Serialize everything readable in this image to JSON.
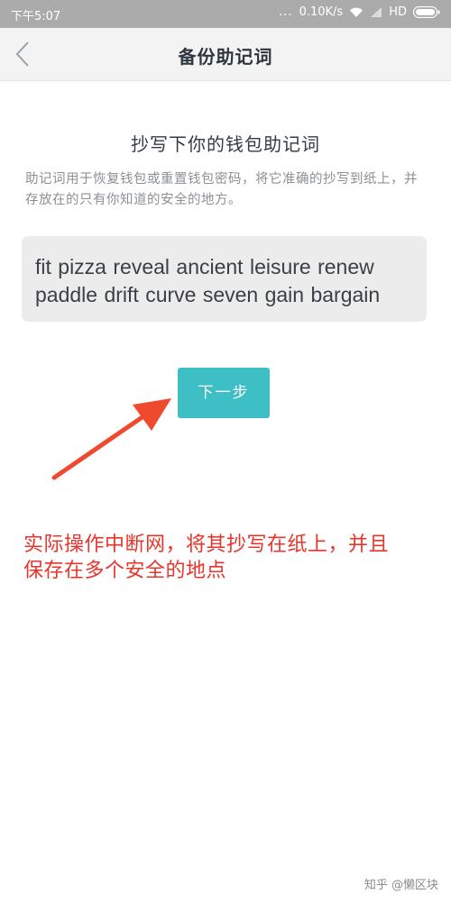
{
  "status_bar": {
    "time": "下午5:07",
    "dots": "...",
    "network_speed": "0.10K/s",
    "network_type": "HD",
    "icons": [
      "wifi-icon",
      "signal-icon",
      "battery-icon"
    ]
  },
  "nav": {
    "back_icon": "chevron-left-icon",
    "title": "备份助记词"
  },
  "content": {
    "section_title": "抄写下你的钱包助记词",
    "description": "助记词用于恢复钱包或重置钱包密码，将它准确的抄写到纸上，并存放在的只有你知道的安全的地方。",
    "mnemonic_line1": "fit pizza reveal ancient leisure renew",
    "mnemonic_line2": "paddle drift curve seven gain bargain",
    "next_button": "下一步"
  },
  "annotation": {
    "line1": "实际操作中断网，将其抄写在纸上，并且",
    "line2": "保存在多个安全的地点",
    "color": "#e8342b"
  },
  "watermark": "知乎 @懒区块",
  "colors": {
    "accent": "#3ebfc6",
    "status_bar": "#ababab",
    "nav_bg": "#f3f3f4",
    "mnemonic_bg": "#ececed"
  }
}
